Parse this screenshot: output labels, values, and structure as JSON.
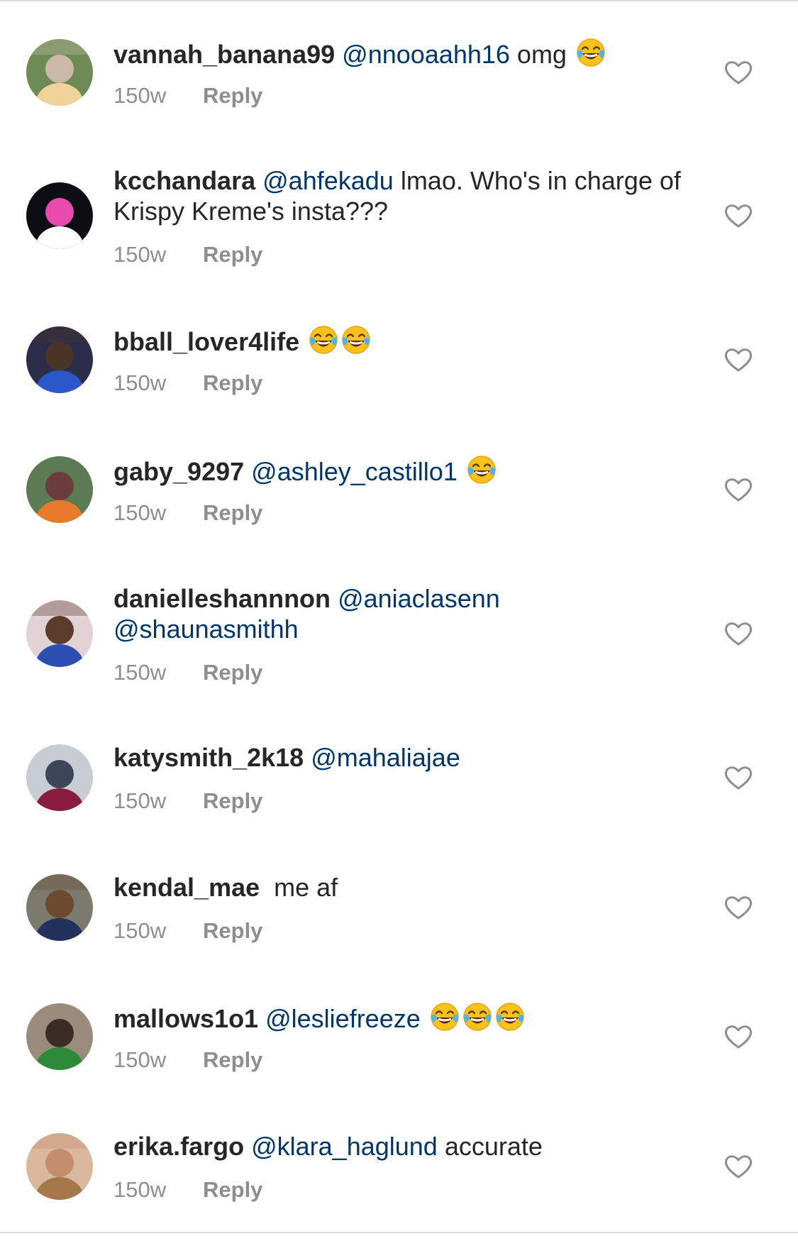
{
  "comments": [
    {
      "username": "vannah_banana99",
      "parts": [
        {
          "t": "mention",
          "v": "@nnooaahh16"
        },
        {
          "t": "text",
          "v": " omg "
        },
        {
          "t": "emoji",
          "v": "😂"
        }
      ],
      "time": "150w",
      "reply": "Reply",
      "avatar": {
        "bg": "#6e8a56",
        "fg": "#c9b9a6",
        "accent": "#f0d39b"
      }
    },
    {
      "username": "kcchandara",
      "parts": [
        {
          "t": "mention",
          "v": "@ahfekadu"
        },
        {
          "t": "text",
          "v": " lmao. Who's in charge of Krispy Kreme's insta???"
        }
      ],
      "time": "150w",
      "reply": "Reply",
      "avatar": {
        "bg": "#0d0d14",
        "fg": "#e84ab0",
        "accent": "#ffffff"
      }
    },
    {
      "username": "bball_lover4life",
      "parts": [
        {
          "t": "emoji",
          "v": "😂"
        },
        {
          "t": "emoji",
          "v": "😂"
        }
      ],
      "time": "150w",
      "reply": "Reply",
      "avatar": {
        "bg": "#2b2d4a",
        "fg": "#4a3426",
        "accent": "#2a58c9"
      }
    },
    {
      "username": "gaby_9297",
      "parts": [
        {
          "t": "mention",
          "v": "@ashley_castillo1"
        },
        {
          "t": "text",
          "v": " "
        },
        {
          "t": "emoji",
          "v": "😂"
        }
      ],
      "time": "150w",
      "reply": "Reply",
      "avatar": {
        "bg": "#5c7a54",
        "fg": "#6a3e3c",
        "accent": "#e77a2b"
      }
    },
    {
      "username": "danielleshannnon",
      "parts": [
        {
          "t": "mention",
          "v": "@aniaclasenn"
        },
        {
          "t": "text",
          "v": " "
        },
        {
          "t": "mention",
          "v": "@shaunasmithh"
        }
      ],
      "time": "150w",
      "reply": "Reply",
      "avatar": {
        "bg": "#e2d2d6",
        "fg": "#5a3b2c",
        "accent": "#2a4fb0"
      }
    },
    {
      "username": "katysmith_2k18",
      "parts": [
        {
          "t": "mention",
          "v": "@mahaliajae"
        }
      ],
      "time": "150w",
      "reply": "Reply",
      "avatar": {
        "bg": "#c8ccd4",
        "fg": "#3d4558",
        "accent": "#8a1c3e"
      }
    },
    {
      "username": "kendal_mae",
      "parts": [
        {
          "t": "text",
          "v": " me af"
        }
      ],
      "time": "150w",
      "reply": "Reply",
      "avatar": {
        "bg": "#7b7a6f",
        "fg": "#6b4a2f",
        "accent": "#23315c"
      }
    },
    {
      "username": "mallows1o1",
      "parts": [
        {
          "t": "mention",
          "v": "@lesliefreeze"
        },
        {
          "t": "text",
          "v": " "
        },
        {
          "t": "emoji",
          "v": "😂"
        },
        {
          "t": "emoji",
          "v": "😂"
        },
        {
          "t": "emoji",
          "v": "😂"
        }
      ],
      "time": "150w",
      "reply": "Reply",
      "avatar": {
        "bg": "#9b8b7d",
        "fg": "#3b2d26",
        "accent": "#2c8a3a"
      }
    },
    {
      "username": "erika.fargo",
      "parts": [
        {
          "t": "mention",
          "v": "@klara_haglund"
        },
        {
          "t": "text",
          "v": " accurate"
        }
      ],
      "time": "150w",
      "reply": "Reply",
      "avatar": {
        "bg": "#d9b89e",
        "fg": "#c48d6e",
        "accent": "#a4784a"
      }
    }
  ],
  "colors": {
    "text": "#262626",
    "mention": "#00376b",
    "meta": "#8e8e8e",
    "heart": "#8e8e8e"
  },
  "icons": {
    "like": "heart-outline-icon",
    "emoji": "face-with-tears-of-joy-icon"
  }
}
